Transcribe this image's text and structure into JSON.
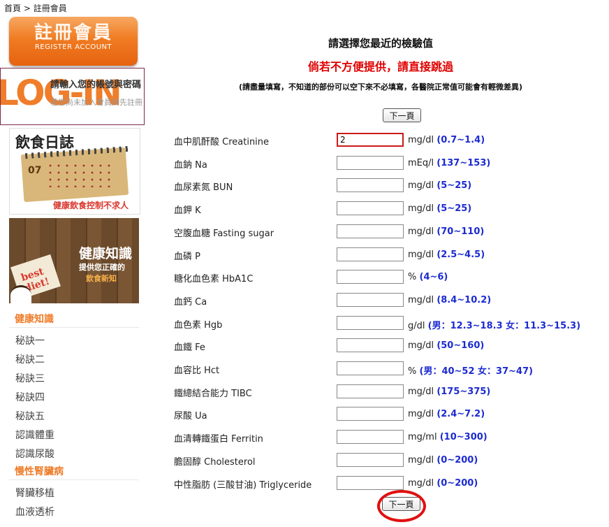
{
  "breadcrumb": {
    "home": "首頁",
    "sep": ">",
    "current": "註冊會員"
  },
  "sidebar": {
    "register_banner": {
      "title": "註冊會員",
      "subtitle": "REGISTER ACCOUNT"
    },
    "login_banner": {
      "big": "LOG-IN",
      "line1": "請輸入您的帳號與密碼",
      "line2": "若您尚未加入會員請先註冊"
    },
    "diary": {
      "title": "飲食日誌",
      "month": "07",
      "caption": "健康飲食控制不求人"
    },
    "knowledge": {
      "title": "健康知識",
      "sub": "提供您正確的",
      "sub2": "飲食新知",
      "note": "best diet!"
    },
    "menu": [
      {
        "type": "cat",
        "label": "健康知識"
      },
      {
        "type": "item",
        "label": "秘訣一"
      },
      {
        "type": "item",
        "label": "秘訣二"
      },
      {
        "type": "item",
        "label": "秘訣三"
      },
      {
        "type": "item",
        "label": "秘訣四"
      },
      {
        "type": "item",
        "label": "秘訣五"
      },
      {
        "type": "item",
        "label": "認識體重"
      },
      {
        "type": "item",
        "label": "認識尿酸"
      },
      {
        "type": "cat",
        "label": "慢性腎臟病"
      },
      {
        "type": "item",
        "label": "腎臟移植"
      },
      {
        "type": "item",
        "label": "血液透析"
      }
    ]
  },
  "main": {
    "heading": "請選擇您最近的檢驗值",
    "warning": "倘若不方便提供，請直接跳過",
    "note": "(請盡量填寫，不知道的部份可以空下來不必填寫，各醫院正常值可能會有輕微差異)",
    "next_label": "下一頁",
    "fields": [
      {
        "label": "血中肌酐酸 Creatinine",
        "value": "2",
        "unit": "mg/dl",
        "range": "(0.7~1.4)"
      },
      {
        "label": "血鈉 Na",
        "value": "",
        "unit": "mEq/l",
        "range": "(137~153)"
      },
      {
        "label": "血尿素氮 BUN",
        "value": "",
        "unit": "mg/dl",
        "range": "(5~25)"
      },
      {
        "label": "血鉀 K",
        "value": "",
        "unit": "mg/dl",
        "range": "(5~25)"
      },
      {
        "label": "空腹血糖 Fasting sugar",
        "value": "",
        "unit": "mg/dl",
        "range": "(70~110)"
      },
      {
        "label": "血磷 P",
        "value": "",
        "unit": "mg/dl",
        "range": "(2.5~4.5)"
      },
      {
        "label": "糖化血色素 HbA1C",
        "value": "",
        "unit": "%",
        "range": "(4~6)"
      },
      {
        "label": "血鈣 Ca",
        "value": "",
        "unit": "mg/dl",
        "range": "(8.4~10.2)"
      },
      {
        "label": "血色素 Hgb",
        "value": "",
        "unit": "g/dl",
        "range": "(男：12.3~18.3 女：11.3~15.3)"
      },
      {
        "label": "血鐵 Fe",
        "value": "",
        "unit": "mg/dl",
        "range": "(50~160)"
      },
      {
        "label": "血容比 Hct",
        "value": "",
        "unit": "%",
        "range": "(男：40~52 女：37~47)"
      },
      {
        "label": "鐵總結合能力 TIBC",
        "value": "",
        "unit": "mg/dl",
        "range": "(175~375)"
      },
      {
        "label": "尿酸 Ua",
        "value": "",
        "unit": "mg/dl",
        "range": "(2.4~7.2)"
      },
      {
        "label": "血清轉鐵蛋白 Ferritin",
        "value": "",
        "unit": "mg/ml",
        "range": "(10~300)"
      },
      {
        "label": "膽固醇 Cholesterol",
        "value": "",
        "unit": "mg/dl",
        "range": "(0~200)"
      },
      {
        "label": "中性脂肪 (三酸甘油) Triglyceride",
        "value": "",
        "unit": "mg/dl",
        "range": "(0~200)"
      }
    ]
  },
  "colors": {
    "accent": "#ef7d2a",
    "warning": "#e00000",
    "range": "#1c2bd0",
    "highlight": "#e01010"
  }
}
